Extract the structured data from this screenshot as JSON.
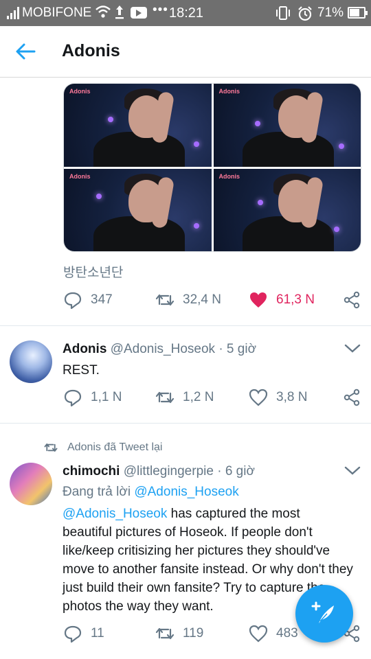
{
  "status_bar": {
    "carrier": "MOBIFONE",
    "time": "18:21",
    "battery_percent": "71%",
    "battery_level": 0.71,
    "icons": [
      "signal-icon",
      "wifi-icon",
      "upload-icon",
      "youtube-icon",
      "more-dots-icon",
      "vibrate-icon",
      "alarm-icon",
      "battery-icon"
    ]
  },
  "header": {
    "title": "Adonis",
    "back_icon": "back-arrow-icon"
  },
  "tweets": [
    {
      "media_watermark": "Adonis",
      "media_count": 4,
      "text": "방탄소년단",
      "replies": "347",
      "retweets": "32,4 N",
      "likes": "61,3 N",
      "liked": true
    },
    {
      "name": "Adonis",
      "handle": "@Adonis_Hoseok",
      "time": "· 5 giờ",
      "text": "REST.",
      "replies": "1,1 N",
      "retweets": "1,2 N",
      "likes": "3,8 N"
    },
    {
      "retweeted_by": "Adonis đã Tweet lại",
      "name": "chimochi",
      "handle": "@littlegingerpie",
      "time": "· 6 giờ",
      "reply_prefix": "Đang trả lời",
      "reply_to": "@Adonis_Hoseok",
      "mention": "@Adonis_Hoseok",
      "text_line1": " has captured the most",
      "text_rest": "beautiful pictures of Hoseok. If people don't like/keep critisizing her pictures they should've move to another fansite instead. Or why don't they just build their own fansite? Try to capture the photos the way they want.",
      "replies": "11",
      "retweets": "119",
      "likes": "483"
    }
  ],
  "colors": {
    "accent": "#1da1f2",
    "like": "#e0245e",
    "muted": "#657786",
    "status_bar": "#6f6f6f"
  }
}
